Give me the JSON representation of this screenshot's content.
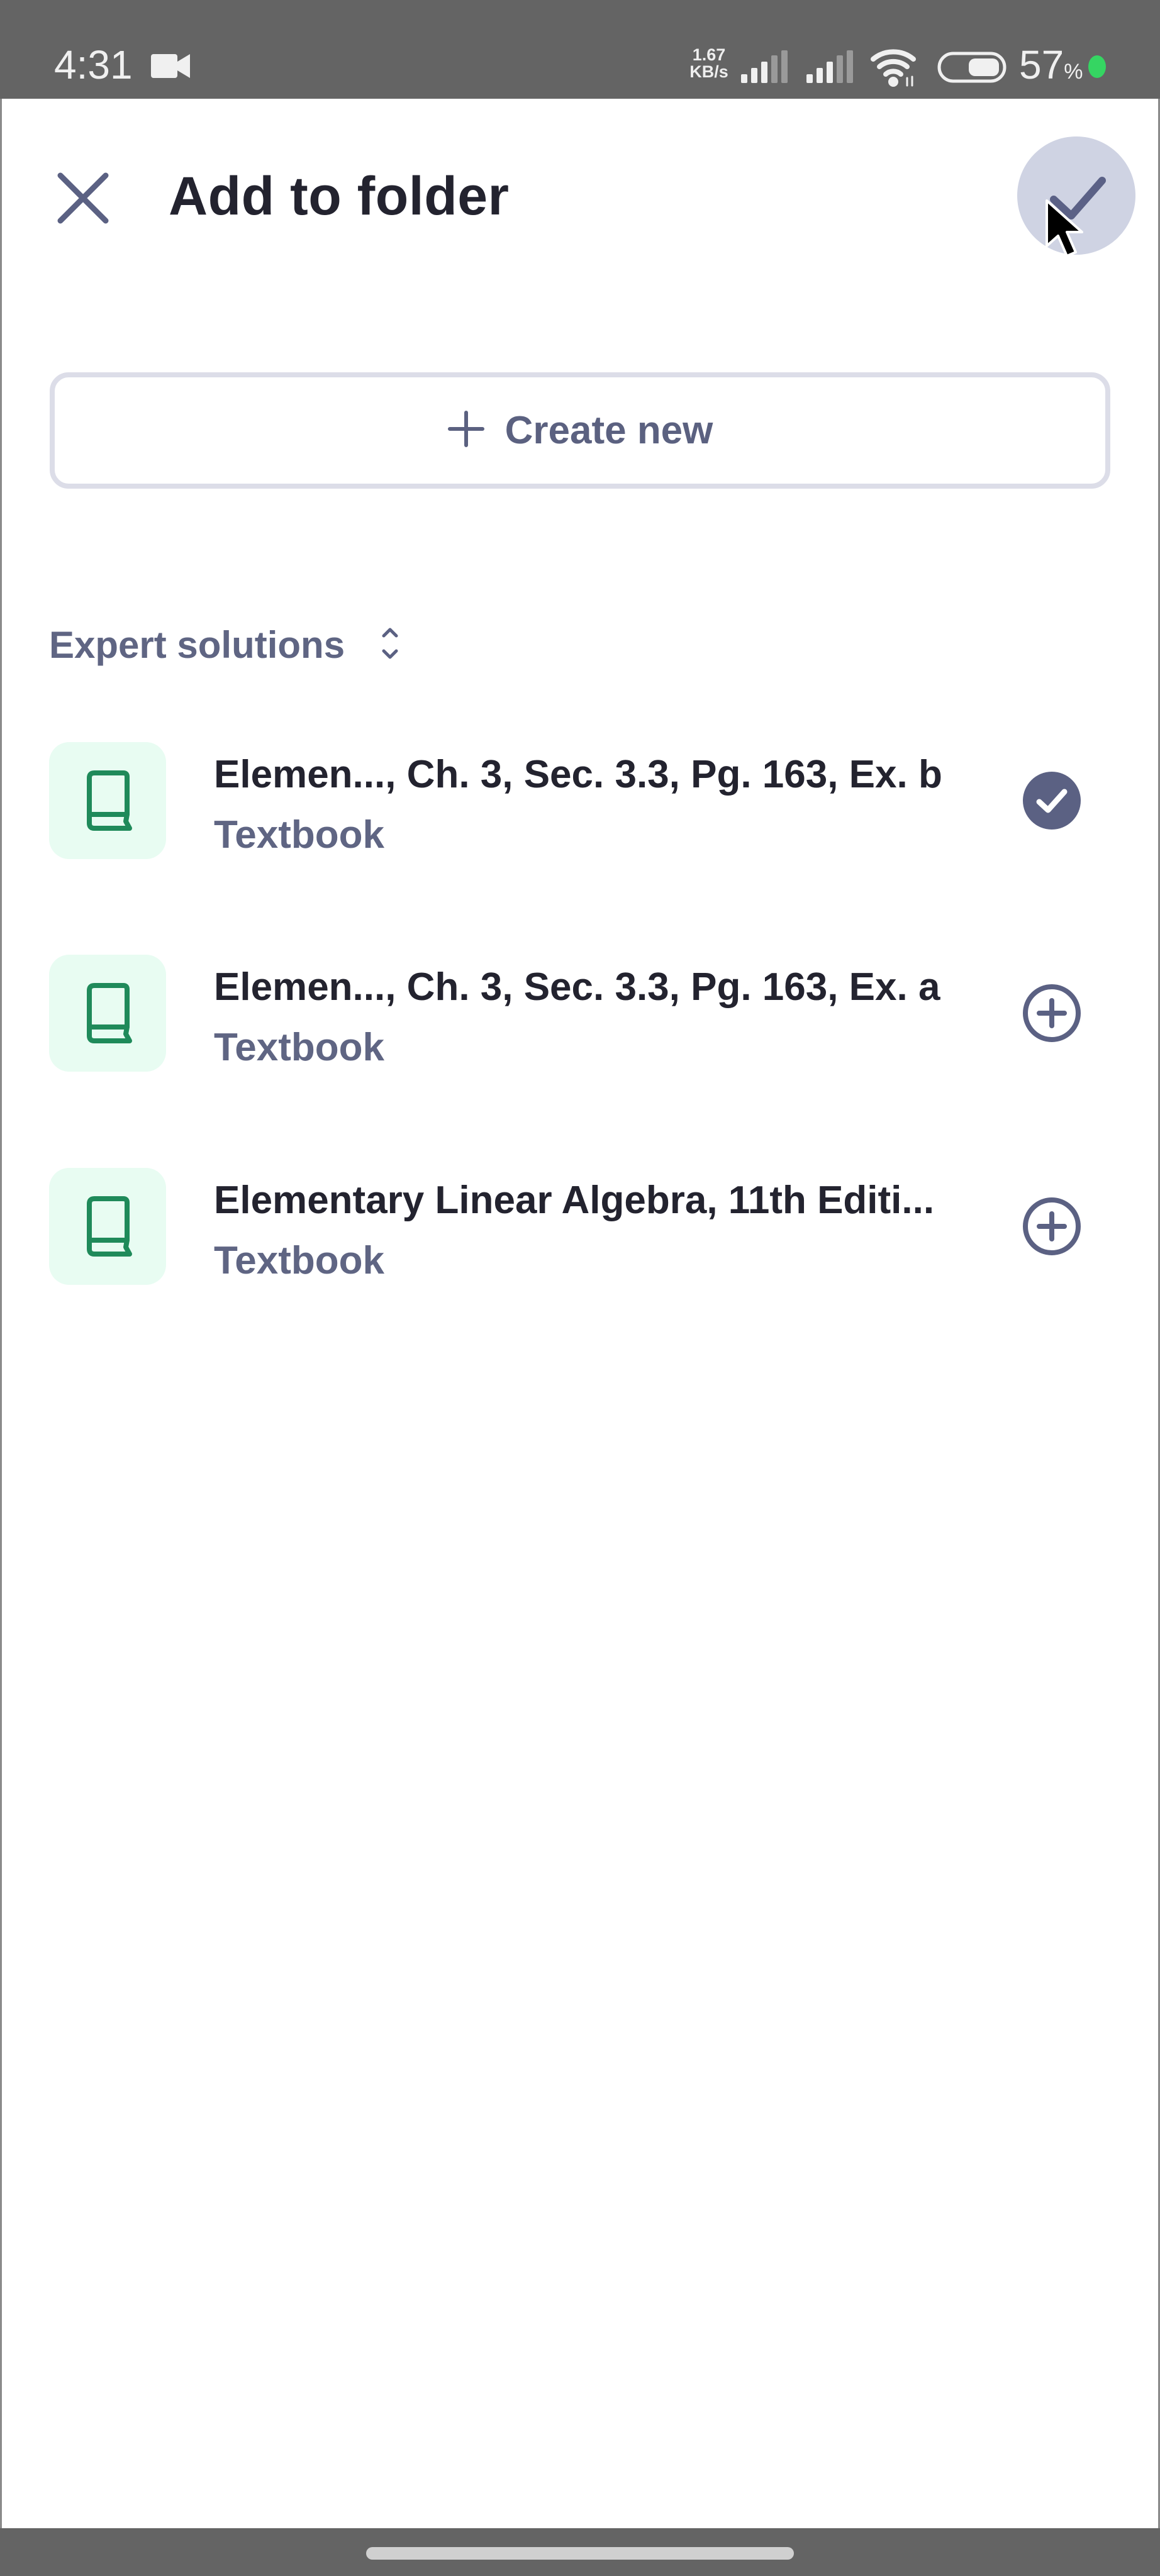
{
  "status_bar": {
    "time": "4:31",
    "recording_icon": "video-camera-icon",
    "network_speed_value": "1.67",
    "network_speed_unit": "KB/s",
    "signal_icons": [
      "signal-bars-icon",
      "signal-bars-icon"
    ],
    "wifi_icon": "wifi-icon",
    "battery_icon": "battery-icon",
    "battery_percent": "57",
    "battery_percent_sign": "%",
    "battery_level": 0.57,
    "indicator_color": "#35d562"
  },
  "header": {
    "close_icon": "close-icon",
    "title": "Add to folder",
    "confirm_icon": "check-icon"
  },
  "create_new": {
    "icon": "plus-icon",
    "label": "Create new"
  },
  "section": {
    "label": "Expert solutions",
    "sort_icon": "sort-chevrons-icon"
  },
  "items": [
    {
      "title": "Elemen..., Ch. 3, Sec. 3.3, Pg. 163, Ex. b",
      "subtitle": "Textbook",
      "icon": "book-icon",
      "added": true,
      "action_icon": "check-circle-filled-icon"
    },
    {
      "title": "Elemen..., Ch. 3, Sec. 3.3, Pg. 163, Ex. a",
      "subtitle": "Textbook",
      "icon": "book-icon",
      "added": false,
      "action_icon": "plus-circle-icon"
    },
    {
      "title": "Elementary Linear Algebra, 11th Editi...",
      "subtitle": "Textbook",
      "icon": "book-icon",
      "added": false,
      "action_icon": "plus-circle-icon"
    }
  ],
  "colors": {
    "title_text": "#23232f",
    "secondary_text": "#5f6583",
    "icon_gray": "#5b6183",
    "book_green": "#1f8a5a",
    "tile_mint": "#e8fcf2",
    "confirm_bg": "#cfd3e3",
    "border": "#dcdde8"
  }
}
